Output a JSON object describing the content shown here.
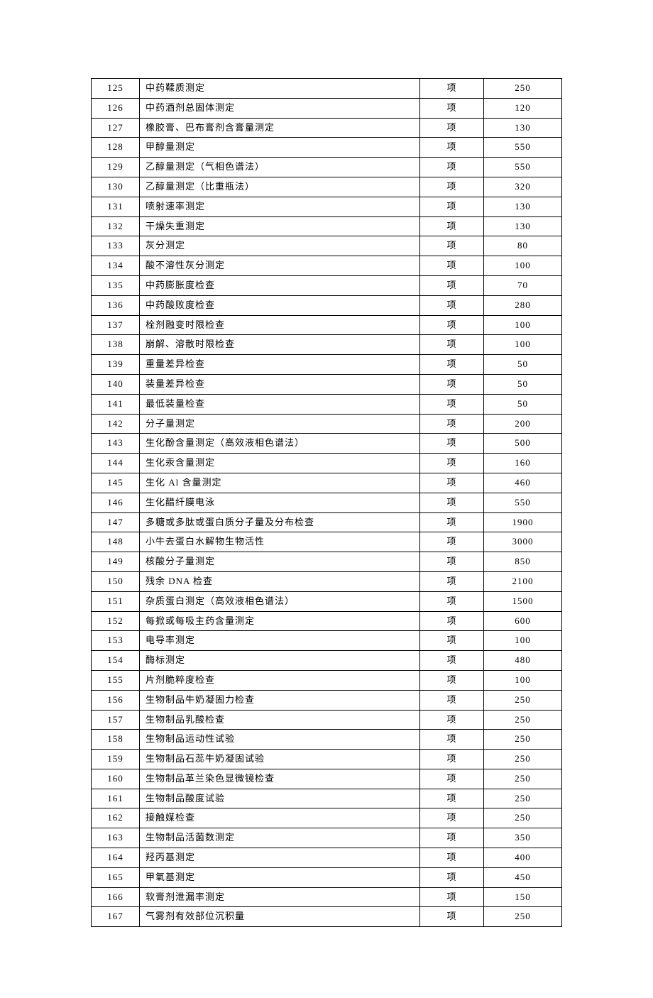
{
  "rows": [
    {
      "num": "125",
      "name": "中药鞣质测定",
      "unit": "项",
      "price": "250"
    },
    {
      "num": "126",
      "name": "中药酒剂总固体测定",
      "unit": "项",
      "price": "120"
    },
    {
      "num": "127",
      "name": "橡胶膏、巴布膏剂含膏量测定",
      "unit": "项",
      "price": "130"
    },
    {
      "num": "128",
      "name": "甲醇量测定",
      "unit": "项",
      "price": "550"
    },
    {
      "num": "129",
      "name": "乙醇量测定（气相色谱法）",
      "unit": "项",
      "price": "550"
    },
    {
      "num": "130",
      "name": "乙醇量测定（比重瓶法）",
      "unit": "项",
      "price": "320"
    },
    {
      "num": "131",
      "name": "喷射速率测定",
      "unit": "项",
      "price": "130"
    },
    {
      "num": "132",
      "name": "干燥失重测定",
      "unit": "项",
      "price": "130"
    },
    {
      "num": "133",
      "name": "灰分测定",
      "unit": "项",
      "price": "80"
    },
    {
      "num": "134",
      "name": "酸不溶性灰分测定",
      "unit": "项",
      "price": "100"
    },
    {
      "num": "135",
      "name": "中药膨胀度检查",
      "unit": "项",
      "price": "70"
    },
    {
      "num": "136",
      "name": "中药酸败度检查",
      "unit": "项",
      "price": "280"
    },
    {
      "num": "137",
      "name": "栓剂融变时限检查",
      "unit": "项",
      "price": "100"
    },
    {
      "num": "138",
      "name": "崩解、溶散时限检查",
      "unit": "项",
      "price": "100"
    },
    {
      "num": "139",
      "name": "重量差异检查",
      "unit": "项",
      "price": "50"
    },
    {
      "num": "140",
      "name": "装量差异检查",
      "unit": "项",
      "price": "50"
    },
    {
      "num": "141",
      "name": "最低装量检查",
      "unit": "项",
      "price": "50"
    },
    {
      "num": "142",
      "name": "分子量测定",
      "unit": "项",
      "price": "200"
    },
    {
      "num": "143",
      "name": "生化酚含量测定（高效液相色谱法）",
      "unit": "项",
      "price": "500"
    },
    {
      "num": "144",
      "name": "生化汞含量测定",
      "unit": "项",
      "price": "160"
    },
    {
      "num": "145",
      "name": "生化 Al 含量测定",
      "unit": "项",
      "price": "460"
    },
    {
      "num": "146",
      "name": "生化醋纤膜电泳",
      "unit": "项",
      "price": "550"
    },
    {
      "num": "147",
      "name": "多糖或多肽或蛋白质分子量及分布检查",
      "unit": "项",
      "price": "1900"
    },
    {
      "num": "148",
      "name": "小牛去蛋白水解物生物活性",
      "unit": "项",
      "price": "3000"
    },
    {
      "num": "149",
      "name": "核酸分子量测定",
      "unit": "项",
      "price": "850"
    },
    {
      "num": "150",
      "name": "残余 DNA 检查",
      "unit": "项",
      "price": "2100"
    },
    {
      "num": "151",
      "name": "杂质蛋白测定（高效液相色谱法）",
      "unit": "项",
      "price": "1500"
    },
    {
      "num": "152",
      "name": "每掀或每吸主药含量测定",
      "unit": "项",
      "price": "600"
    },
    {
      "num": "153",
      "name": "电导率测定",
      "unit": "项",
      "price": "100"
    },
    {
      "num": "154",
      "name": "酶标测定",
      "unit": "项",
      "price": "480"
    },
    {
      "num": "155",
      "name": "片剂脆粹度检查",
      "unit": "项",
      "price": "100"
    },
    {
      "num": "156",
      "name": "生物制品牛奶凝固力检查",
      "unit": "项",
      "price": "250"
    },
    {
      "num": "157",
      "name": "生物制品乳酸检查",
      "unit": "项",
      "price": "250"
    },
    {
      "num": "158",
      "name": "生物制品运动性试验",
      "unit": "项",
      "price": "250"
    },
    {
      "num": "159",
      "name": "生物制品石蕊牛奶凝固试验",
      "unit": "项",
      "price": "250"
    },
    {
      "num": "160",
      "name": "生物制品革兰染色显微镜检查",
      "unit": "项",
      "price": "250"
    },
    {
      "num": "161",
      "name": "生物制品酸度试验",
      "unit": "项",
      "price": "250"
    },
    {
      "num": "162",
      "name": "接触媒检查",
      "unit": "项",
      "price": "250"
    },
    {
      "num": "163",
      "name": "生物制品活菌数测定",
      "unit": "项",
      "price": "350"
    },
    {
      "num": "164",
      "name": "羟丙基测定",
      "unit": "项",
      "price": "400"
    },
    {
      "num": "165",
      "name": "甲氧基测定",
      "unit": "项",
      "price": "450"
    },
    {
      "num": "166",
      "name": "软膏剂泄漏率测定",
      "unit": "项",
      "price": "150"
    },
    {
      "num": "167",
      "name": "气雾剂有效部位沉积量",
      "unit": "项",
      "price": "250"
    }
  ]
}
